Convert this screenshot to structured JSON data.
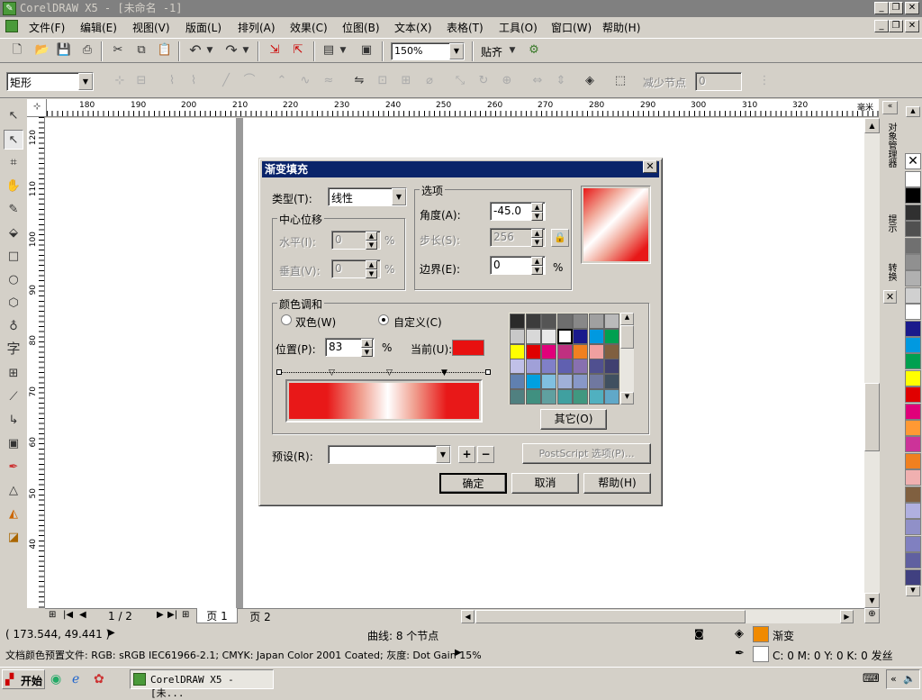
{
  "window": {
    "title": "CorelDRAW X5 - [未命名 -1]"
  },
  "menus": [
    "文件(F)",
    "编辑(E)",
    "视图(V)",
    "版面(L)",
    "排列(A)",
    "效果(C)",
    "位图(B)",
    "文本(X)",
    "表格(T)",
    "工具(O)",
    "窗口(W)",
    "帮助(H)"
  ],
  "toolbar": {
    "zoom": "150%",
    "snap": "贴齐"
  },
  "propbar": {
    "shape": "矩形",
    "reduce_nodes": "减少节点",
    "nodes_value": "0"
  },
  "ruler": {
    "top": [
      "180",
      "190",
      "200",
      "210",
      "220",
      "230",
      "240",
      "250",
      "260",
      "270",
      "280",
      "290",
      "300",
      "310",
      "320"
    ],
    "unit": "毫米",
    "left": [
      "120",
      "110",
      "100",
      "90",
      "80",
      "70",
      "60",
      "50",
      "40"
    ]
  },
  "docker": {
    "tab1": "对象管理器",
    "tab2": "提示",
    "tab3": "转换"
  },
  "palette": {
    "colors": [
      "#ffffff",
      "#000000",
      "#303030",
      "#505050",
      "#707070",
      "#909090",
      "#b0b0b0",
      "#d0d0d0",
      "#ffffff",
      "#1a1a8c",
      "#0099e0",
      "#00a050",
      "#ffff00",
      "#e00000",
      "#e0007a",
      "#ff9933",
      "#cc3399",
      "#f08020",
      "#f0b0b0",
      "#806040",
      "#b0b0e0",
      "#9090c8",
      "#8080c0",
      "#6060a0",
      "#404080"
    ]
  },
  "dialog": {
    "title": "渐变填充",
    "type_label": "类型(T):",
    "type_value": "线性",
    "center_group": "中心位移",
    "h_label": "水平(I):",
    "h_value": "0",
    "v_label": "垂直(V):",
    "v_value": "0",
    "pct": "%",
    "options_group": "选项",
    "angle_label": "角度(A):",
    "angle_value": "-45.0",
    "steps_label": "步长(S):",
    "steps_value": "256",
    "edge_label": "边界(E):",
    "edge_value": "0",
    "blend_group": "颜色调和",
    "two_color": "双色(W)",
    "custom": "自定义(C)",
    "pos_label": "位置(P):",
    "pos_value": "83",
    "current_label": "当前(U):",
    "current_color": "#e81010",
    "others": "其它(O)",
    "preset_label": "预设(R):",
    "ps_options": "PostScript 选项(P)...",
    "ok": "确定",
    "cancel": "取消",
    "help": "帮助(H)",
    "grid": [
      "#2a2a2a",
      "#3c3c3c",
      "#555555",
      "#6e6e6e",
      "#888888",
      "#a0a0a0",
      "#bababa",
      "#c8c8c8",
      "#d8d8d8",
      "#e8e8e8",
      "#ffffff",
      "#1a1a8c",
      "#0099e0",
      "#00a050",
      "#ffff00",
      "#e00000",
      "#e0007a",
      "#c03080",
      "#f08020",
      "#f0a0a0",
      "#806040",
      "#c0c0e8",
      "#a0a0d8",
      "#8080c8",
      "#6060b0",
      "#8870b0",
      "#505090",
      "#404070",
      "#6080b0",
      "#00a0e0",
      "#80c0e0",
      "#a0b0d8",
      "#8898c8",
      "#7078a0",
      "#405060",
      "#508080",
      "#409080",
      "#60a0a0",
      "#40a0a0",
      "#409880",
      "#50b0c0",
      "#60a8c8"
    ]
  },
  "pages": {
    "counter": "1 / 2",
    "page1": "页 1",
    "page2": "页 2"
  },
  "status": {
    "coords": "( 173.544, 49.441 )",
    "object": "曲线: 8 个节点",
    "fill_label": "渐变",
    "profile": "文档颜色预置文件: RGB: sRGB IEC61966-2.1; CMYK: Japan Color 2001 Coated; 灰度: Dot Gain 15%",
    "outline": "C: 0 M: 0 Y: 0 K: 0 发丝"
  },
  "taskbar": {
    "start": "开始",
    "task": "CorelDRAW X5 - [未..."
  }
}
